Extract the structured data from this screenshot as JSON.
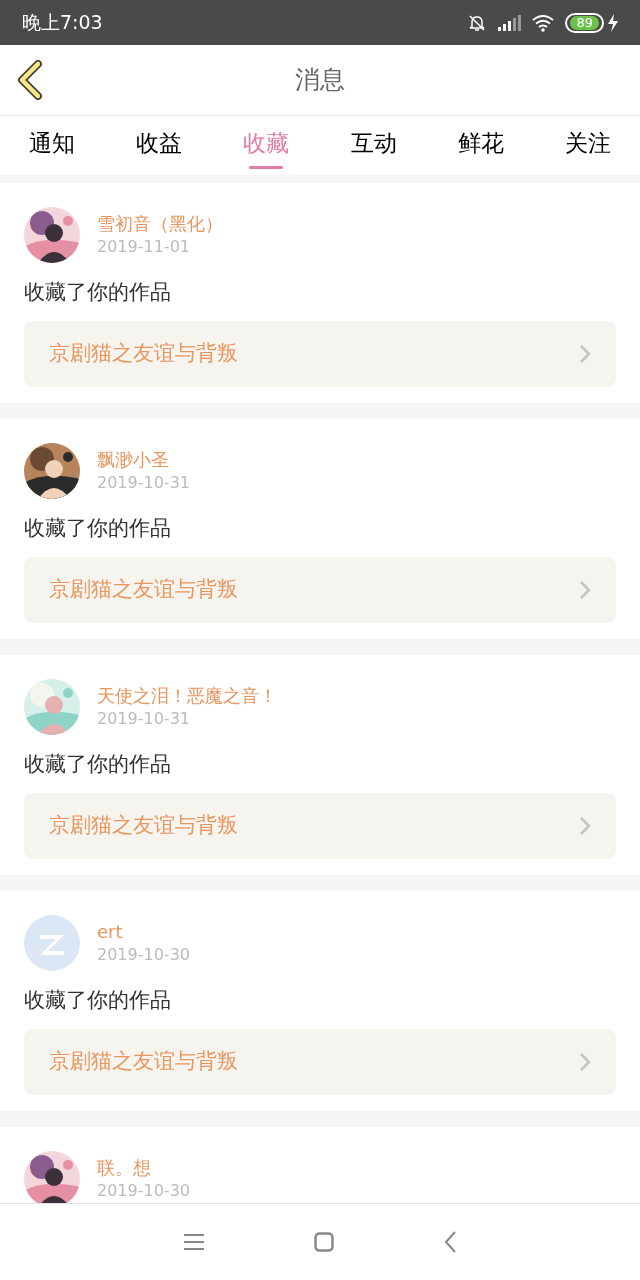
{
  "status_bar": {
    "time": "晚上7:03",
    "battery": "89"
  },
  "header": {
    "title": "消息"
  },
  "tabs": [
    {
      "label": "通知",
      "selected": false
    },
    {
      "label": "收益",
      "selected": false
    },
    {
      "label": "收藏",
      "selected": true
    },
    {
      "label": "互动",
      "selected": false
    },
    {
      "label": "鲜花",
      "selected": false
    },
    {
      "label": "关注",
      "selected": false
    }
  ],
  "messages": [
    {
      "name": "雪初音（黑化）",
      "date": "2019-11-01",
      "action": "收藏了你的作品",
      "work": "京剧猫之友谊与背叛"
    },
    {
      "name": "飘渺小圣",
      "date": "2019-10-31",
      "action": "收藏了你的作品",
      "work": "京剧猫之友谊与背叛"
    },
    {
      "name": "天使之泪！恶魔之音！",
      "date": "2019-10-31",
      "action": "收藏了你的作品",
      "work": "京剧猫之友谊与背叛"
    },
    {
      "name": "ert",
      "date": "2019-10-30",
      "avatar": {
        "kind": "default"
      },
      "action": "收藏了你的作品",
      "work": "京剧猫之友谊与背叛"
    },
    {
      "name": "联。想",
      "date": "2019-10-30"
    }
  ]
}
